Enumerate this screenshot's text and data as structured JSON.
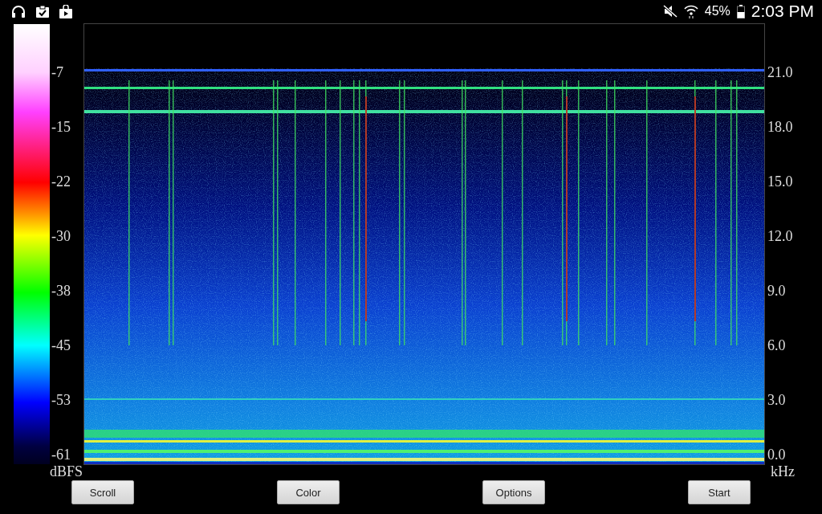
{
  "status_bar": {
    "battery": "45%",
    "time": "2:03 PM"
  },
  "color_scale": {
    "labels": [
      "-7",
      "-15",
      "-22",
      "-30",
      "-38",
      "-45",
      "-53",
      "-61"
    ],
    "unit": "dBFS"
  },
  "frequency_axis": {
    "labels": [
      "21.0",
      "18.0",
      "15.0",
      "12.0",
      "9.0",
      "6.0",
      "3.0",
      "0.0"
    ],
    "unit": "kHz"
  },
  "buttons": [
    "Scroll",
    "Color",
    "Options",
    "Start"
  ]
}
